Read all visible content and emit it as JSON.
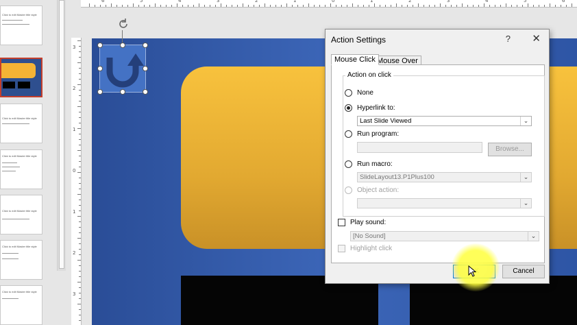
{
  "colors": {
    "slide_blue": "#3c66b8",
    "slide_yellow": "#f8c23d",
    "accent_red": "#c43e2b",
    "shape_blue": "#4472c4"
  },
  "thumbnails": [
    {
      "text": "Click to edit Master title style"
    },
    {
      "text": ""
    },
    {
      "text": "Click to edit Master title style"
    },
    {
      "text": "Click to edit Master title style"
    },
    {
      "text": "Click to edit Master title style"
    },
    {
      "text": "Click to edit Master title style"
    },
    {
      "text": "Click to edit Master title style"
    }
  ],
  "top_ruler": {
    "labels": [
      "6",
      "5",
      "4",
      "3",
      "2",
      "1",
      "0",
      "1",
      "2",
      "3",
      "4",
      "5",
      "6"
    ]
  },
  "left_ruler": {
    "labels": [
      "3",
      "2",
      "1",
      "0",
      "1",
      "2",
      "3"
    ]
  },
  "dialog": {
    "title": "Action Settings",
    "help": "?",
    "close": "✕",
    "tabs": [
      {
        "label": "Mouse Click"
      },
      {
        "label": "Mouse Over"
      }
    ],
    "group_label": "Action on click",
    "none_label": "None",
    "hyperlink_label": "Hyperlink to:",
    "hyperlink_value": "Last Slide Viewed",
    "run_program_label": "Run program:",
    "browse_label": "Browse...",
    "run_macro_label": "Run macro:",
    "macro_value": "SlideLayout13.P1Plus100",
    "object_action_label": "Object action:",
    "play_sound_label": "Play sound:",
    "sound_value": "[No Sound]",
    "highlight_label": "Highlight click",
    "ok_label": "OK",
    "cancel_label": "Cancel"
  }
}
